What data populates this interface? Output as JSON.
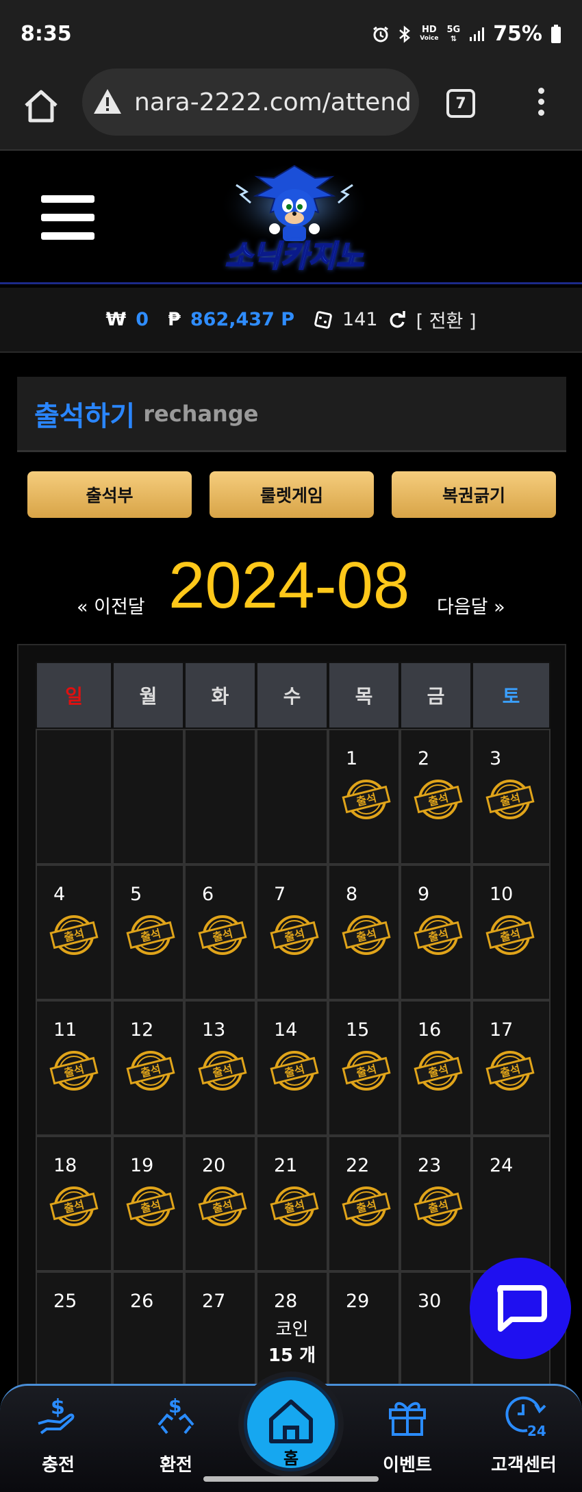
{
  "status_bar": {
    "time": "8:35",
    "battery": "75%",
    "network_hd": "HD",
    "network_voice": "Voice",
    "network_5g": "5G",
    "icons": [
      "alarm-icon",
      "bluetooth-icon",
      "hd-voice-icon",
      "5g-icon",
      "signal-icon",
      "battery-icon"
    ]
  },
  "browser": {
    "url": "nara-2222.com/attend",
    "tab_count": "7",
    "icons": [
      "home-icon",
      "warning-icon",
      "tabs-icon",
      "more-icon"
    ]
  },
  "site": {
    "logo_text": "소닉카지노"
  },
  "balance": {
    "won_symbol": "₩",
    "won_value": "0",
    "point_symbol": "₱",
    "point_value": "862,437 P",
    "ticket_value": "141",
    "convert_label": "[ 전환 ]"
  },
  "page": {
    "title": "출석하기",
    "subtitle": "rechange"
  },
  "buttons": {
    "attendance_book": "출석부",
    "roulette_game": "룰렛게임",
    "lottery_scratch": "복권긁기"
  },
  "month_nav": {
    "prev": "« 이전달",
    "current": "2024-08",
    "next": "다음달 »"
  },
  "calendar": {
    "weekdays": [
      "일",
      "월",
      "화",
      "수",
      "목",
      "금",
      "토"
    ],
    "weekday_colors": [
      "#e01010",
      "#dddddd",
      "#dddddd",
      "#dddddd",
      "#dddddd",
      "#dddddd",
      "#3aa0ff"
    ],
    "stamp_label": "출석",
    "weeks": [
      [
        {
          "day": "",
          "stamp": false
        },
        {
          "day": "",
          "stamp": false
        },
        {
          "day": "",
          "stamp": false
        },
        {
          "day": "",
          "stamp": false
        },
        {
          "day": "1",
          "stamp": true
        },
        {
          "day": "2",
          "stamp": true
        },
        {
          "day": "3",
          "stamp": true
        }
      ],
      [
        {
          "day": "4",
          "stamp": true
        },
        {
          "day": "5",
          "stamp": true
        },
        {
          "day": "6",
          "stamp": true
        },
        {
          "day": "7",
          "stamp": true
        },
        {
          "day": "8",
          "stamp": true
        },
        {
          "day": "9",
          "stamp": true
        },
        {
          "day": "10",
          "stamp": true
        }
      ],
      [
        {
          "day": "11",
          "stamp": true
        },
        {
          "day": "12",
          "stamp": true
        },
        {
          "day": "13",
          "stamp": true
        },
        {
          "day": "14",
          "stamp": true
        },
        {
          "day": "15",
          "stamp": true
        },
        {
          "day": "16",
          "stamp": true
        },
        {
          "day": "17",
          "stamp": true
        }
      ],
      [
        {
          "day": "18",
          "stamp": true
        },
        {
          "day": "19",
          "stamp": true
        },
        {
          "day": "20",
          "stamp": true
        },
        {
          "day": "21",
          "stamp": true
        },
        {
          "day": "22",
          "stamp": true
        },
        {
          "day": "23",
          "stamp": true
        },
        {
          "day": "24",
          "stamp": false
        }
      ],
      [
        {
          "day": "25",
          "stamp": false
        },
        {
          "day": "26",
          "stamp": false
        },
        {
          "day": "27",
          "stamp": false
        },
        {
          "day": "28",
          "stamp": false,
          "coin_label": "코인",
          "coin_count": "15 개"
        },
        {
          "day": "29",
          "stamp": false
        },
        {
          "day": "30",
          "stamp": false
        },
        {
          "day": "",
          "stamp": false
        }
      ]
    ]
  },
  "bottom_nav": {
    "items": [
      {
        "label": "충전",
        "icon": "deposit-icon"
      },
      {
        "label": "환전",
        "icon": "withdraw-icon"
      },
      {
        "label": "홈",
        "icon": "home-icon"
      },
      {
        "label": "이벤트",
        "icon": "gift-icon"
      },
      {
        "label": "고객센터",
        "icon": "support-24-icon"
      }
    ]
  },
  "colors": {
    "accent_blue": "#2a86ff",
    "gold": "#ffc81a",
    "chat_button": "#1f10f0",
    "home_button": "#16a7f0"
  }
}
